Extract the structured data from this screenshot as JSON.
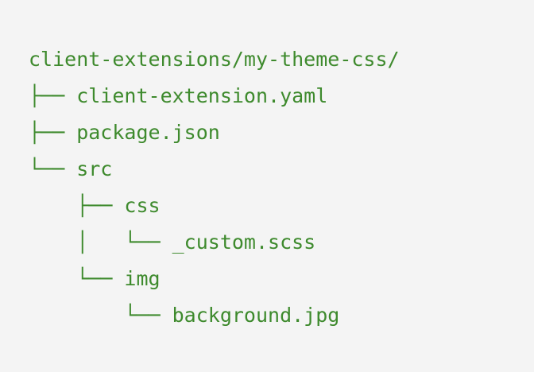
{
  "code_block": {
    "lines": [
      "client-extensions/my-theme-css/",
      "├── client-extension.yaml",
      "├── package.json",
      "└── src",
      "    ├── css",
      "    │   └── _custom.scss",
      "    └── img",
      "        └── background.jpg"
    ]
  },
  "colors": {
    "background": "#f4f4f4",
    "text": "#3e8a2d"
  }
}
